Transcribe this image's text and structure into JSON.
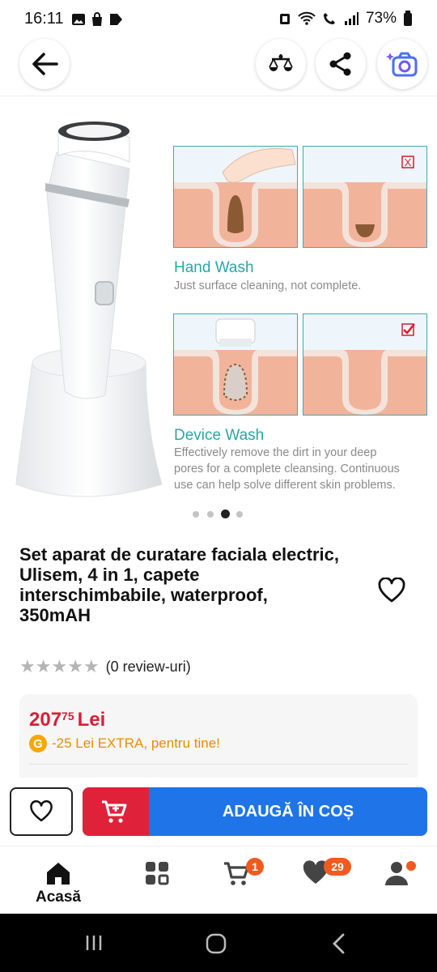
{
  "status_bar": {
    "time": "16:11",
    "battery": "73%"
  },
  "top_bar": {
    "icons": [
      "back-arrow-icon",
      "compare-scale-icon",
      "share-icon",
      "camera-search-icon"
    ]
  },
  "product_image": {
    "panel_top_left_marker": "X",
    "hand_wash_title": "Hand Wash",
    "hand_wash_text": "Just surface cleaning, not complete.",
    "device_wash_title": "Device Wash",
    "device_wash_text_1": "Effectively remove the dirt in your deep",
    "device_wash_text_2": "pores for a complete cleansing. Continuous",
    "device_wash_text_3": "use can help solve different skin problems."
  },
  "carousel": {
    "count": 4,
    "active_index": 2
  },
  "product": {
    "title": "Set aparat de curatare faciala electric, Ulisem, 4 in 1, capete interschimbabile, waterproof, 350mAH",
    "rating": 0,
    "review_count_text": "(0 review-uri)",
    "price_whole": "207",
    "price_cents": "75",
    "price_currency": "Lei",
    "genius_badge": "G",
    "extra_discount_text": "-25 Lei EXTRA, pentru tine!"
  },
  "cta": {
    "add_to_cart_label": "ADAUGĂ ÎN COȘ"
  },
  "bottom_nav": {
    "home_label": "Acasă",
    "cart_badge": "1",
    "favorites_badge": "29"
  },
  "colors": {
    "price_red": "#d91e36",
    "cta_blue": "#1f74e8",
    "cta_red": "#e0213a",
    "genius_orange": "#e98c00",
    "badge_orange": "#f05a1f",
    "caption_teal": "#2aa6a6"
  }
}
